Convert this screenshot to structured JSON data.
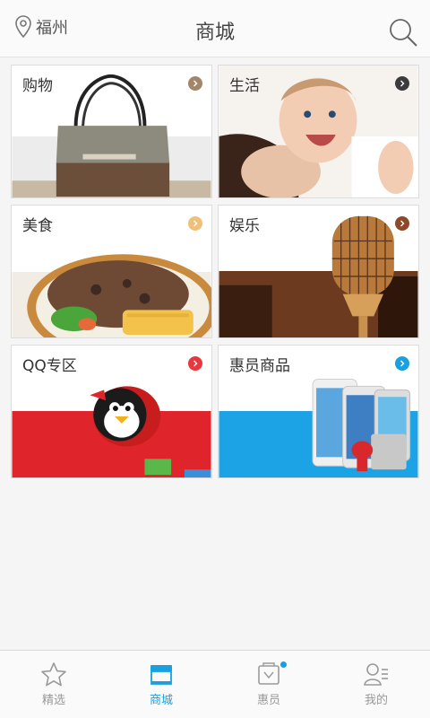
{
  "header": {
    "city": "福州",
    "title": "商城",
    "icons": {
      "location": "location-pin-icon",
      "search": "search-icon"
    }
  },
  "categories": [
    {
      "label": "购物",
      "arrow_color": "#a1876a"
    },
    {
      "label": "生活",
      "arrow_color": "#3b3b3b"
    },
    {
      "label": "美食",
      "arrow_color": "#efc07a"
    },
    {
      "label": "娱乐",
      "arrow_color": "#8c4a2a"
    },
    {
      "label": "QQ专区",
      "arrow_color": "#e8383d"
    },
    {
      "label": "惠员商品",
      "arrow_color": "#1aa0e0"
    }
  ],
  "tabs": [
    {
      "label": "精选",
      "icon": "star-icon",
      "active": false
    },
    {
      "label": "商城",
      "icon": "shop-icon",
      "active": true
    },
    {
      "label": "惠员",
      "icon": "member-card-icon",
      "active": false,
      "badge": true
    },
    {
      "label": "我的",
      "icon": "profile-icon",
      "active": false
    }
  ],
  "colors": {
    "accent": "#1aa0e0",
    "inactive": "#999999"
  }
}
